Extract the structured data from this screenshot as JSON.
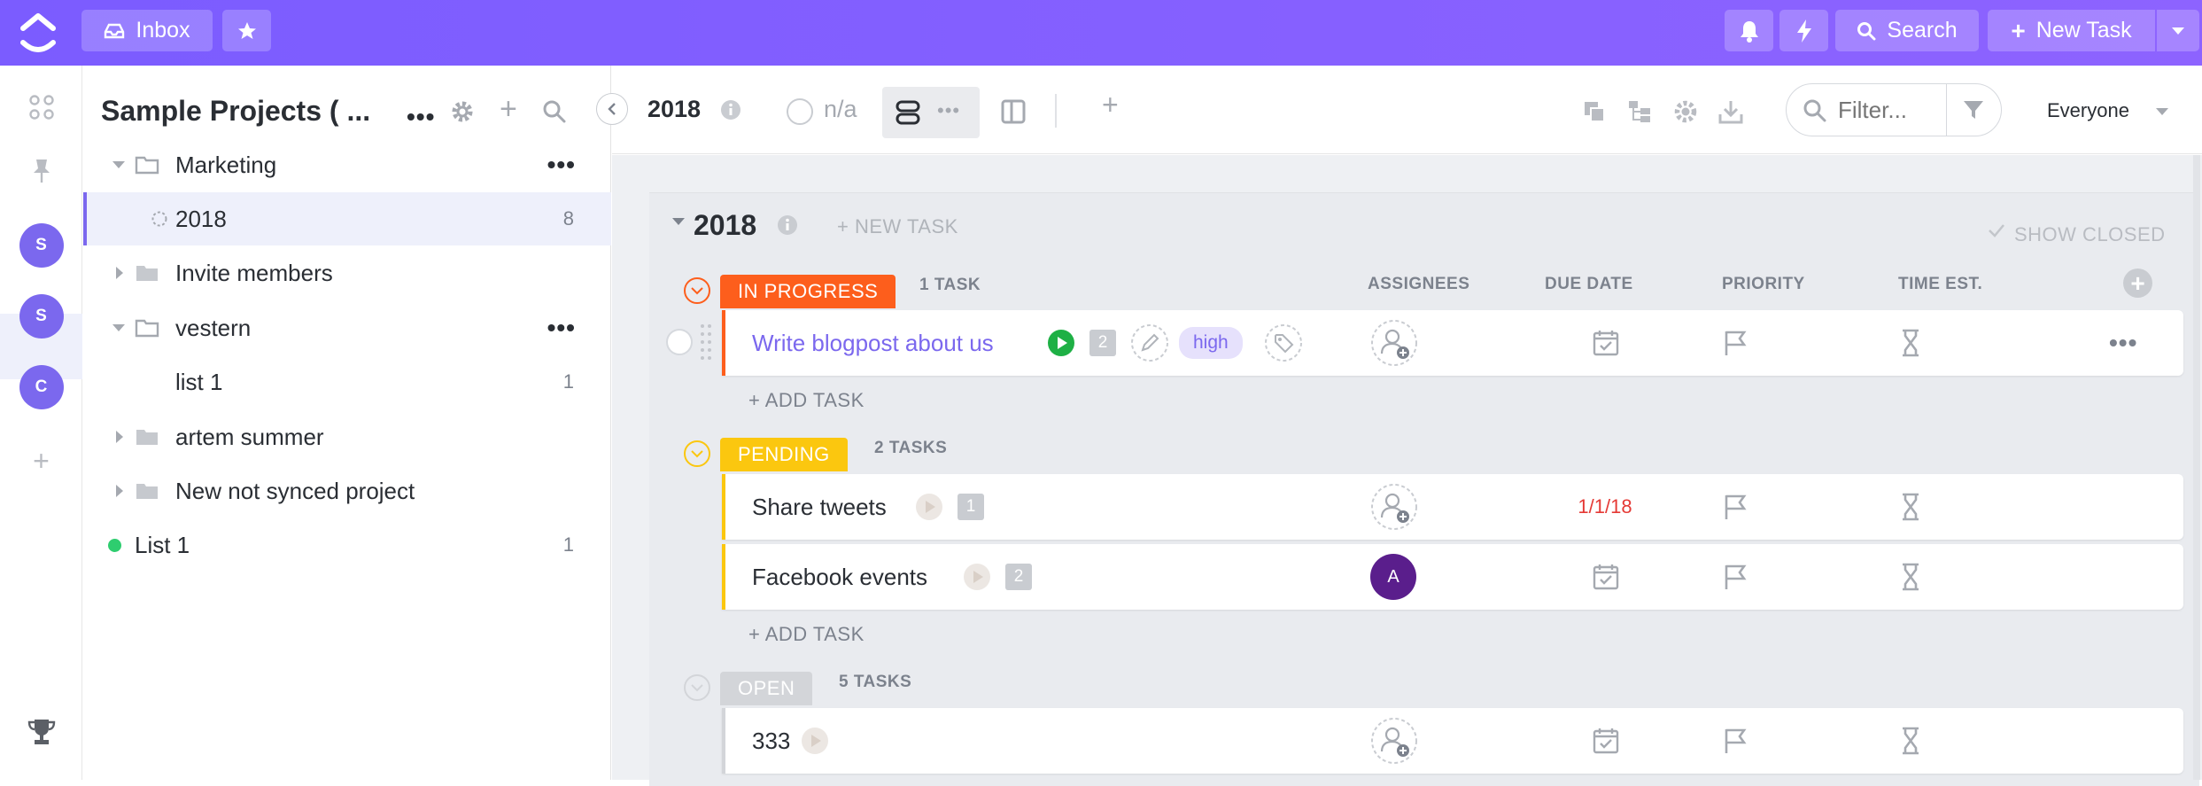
{
  "topbar": {
    "inbox_label": "Inbox",
    "search_label": "Search",
    "new_task_label": "New Task"
  },
  "rail": {
    "avatars": [
      "S",
      "S",
      "C"
    ]
  },
  "sidebar": {
    "title": "Sample Projects ( ...",
    "items": [
      {
        "label": "Marketing"
      },
      {
        "label": "2018",
        "count": "8"
      },
      {
        "label": "Invite members"
      },
      {
        "label": "vestern"
      },
      {
        "label": "list 1",
        "count": "1"
      },
      {
        "label": "artem summer"
      },
      {
        "label": "New not synced project"
      },
      {
        "label": "List 1",
        "count": "1"
      }
    ]
  },
  "header": {
    "list_title": "2018",
    "status_label": "n/a",
    "filter_placeholder": "Filter...",
    "everyone_label": "Everyone"
  },
  "board": {
    "group_title": "2018",
    "new_task_label": "+ NEW TASK",
    "show_closed_label": "SHOW CLOSED",
    "columns": [
      "ASSIGNEES",
      "DUE DATE",
      "PRIORITY",
      "TIME EST."
    ],
    "add_task_label": "+ ADD TASK",
    "groups": [
      {
        "status": "IN PROGRESS",
        "count": "1 TASK",
        "color": "#fd5e1c"
      },
      {
        "status": "PENDING",
        "count": "2 TASKS",
        "color": "#fbc70f"
      },
      {
        "status": "OPEN",
        "count": "5 TASKS",
        "color": "#d3d5d9"
      }
    ],
    "tasks": [
      {
        "name": "Write blogpost about us",
        "subtasks": "2",
        "tag": "high"
      },
      {
        "name": "Share tweets",
        "subtasks": "1",
        "due": "1/1/18"
      },
      {
        "name": "Facebook events",
        "subtasks": "2",
        "assignee": "A"
      },
      {
        "name": "333"
      }
    ]
  },
  "colors": {
    "accent": "#7b68ee",
    "in_progress": "#fd5e1c",
    "pending": "#fbc70f",
    "open": "#d3d5d9",
    "due_overdue": "#e53935",
    "play_green": "#1eb045"
  }
}
